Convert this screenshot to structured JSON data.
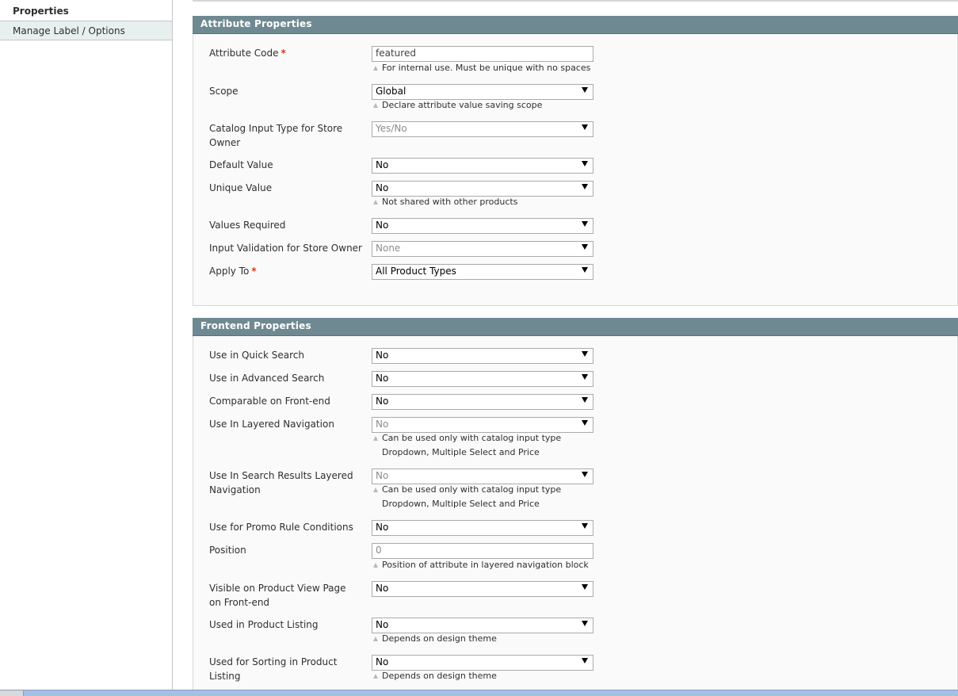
{
  "tabs": {
    "properties": "Properties",
    "manage_label_options": "Manage Label / Options"
  },
  "attribute_properties": {
    "title": "Attribute Properties",
    "attribute_code": {
      "label": "Attribute Code",
      "value": "featured",
      "note": "For internal use. Must be unique with no spaces"
    },
    "scope": {
      "label": "Scope",
      "value": "Global",
      "note": "Declare attribute value saving scope"
    },
    "catalog_input_type": {
      "label": "Catalog Input Type for Store Owner",
      "value": "Yes/No"
    },
    "default_value": {
      "label": "Default Value",
      "value": "No"
    },
    "unique_value": {
      "label": "Unique Value",
      "value": "No",
      "note": "Not shared with other products"
    },
    "values_required": {
      "label": "Values Required",
      "value": "No"
    },
    "input_validation": {
      "label": "Input Validation for Store Owner",
      "value": "None"
    },
    "apply_to": {
      "label": "Apply To",
      "value": "All Product Types"
    },
    "required_marker": "*"
  },
  "frontend_properties": {
    "title": "Frontend Properties",
    "quick_search": {
      "label": "Use in Quick Search",
      "value": "No"
    },
    "advanced_search": {
      "label": "Use in Advanced Search",
      "value": "No"
    },
    "comparable": {
      "label": "Comparable on Front-end",
      "value": "No"
    },
    "layered_nav": {
      "label": "Use In Layered Navigation",
      "value": "No",
      "note_line1": "Can be used only with catalog input type",
      "note_line2": "Dropdown, Multiple Select and Price"
    },
    "search_layered_nav": {
      "label": "Use In Search Results Layered Navigation",
      "value": "No",
      "note_line1": "Can be used only with catalog input type",
      "note_line2": "Dropdown, Multiple Select and Price"
    },
    "promo_rule": {
      "label": "Use for Promo Rule Conditions",
      "value": "No"
    },
    "position": {
      "label": "Position",
      "value": "0",
      "note": "Position of attribute in layered navigation block"
    },
    "visible_on_view": {
      "label": "Visible on Product View Page on Front-end",
      "value": "No"
    },
    "product_listing": {
      "label": "Used in Product Listing",
      "value": "No",
      "note": "Depends on design theme"
    },
    "sorting": {
      "label": "Used for Sorting in Product Listing",
      "value": "No",
      "note": "Depends on design theme"
    }
  }
}
